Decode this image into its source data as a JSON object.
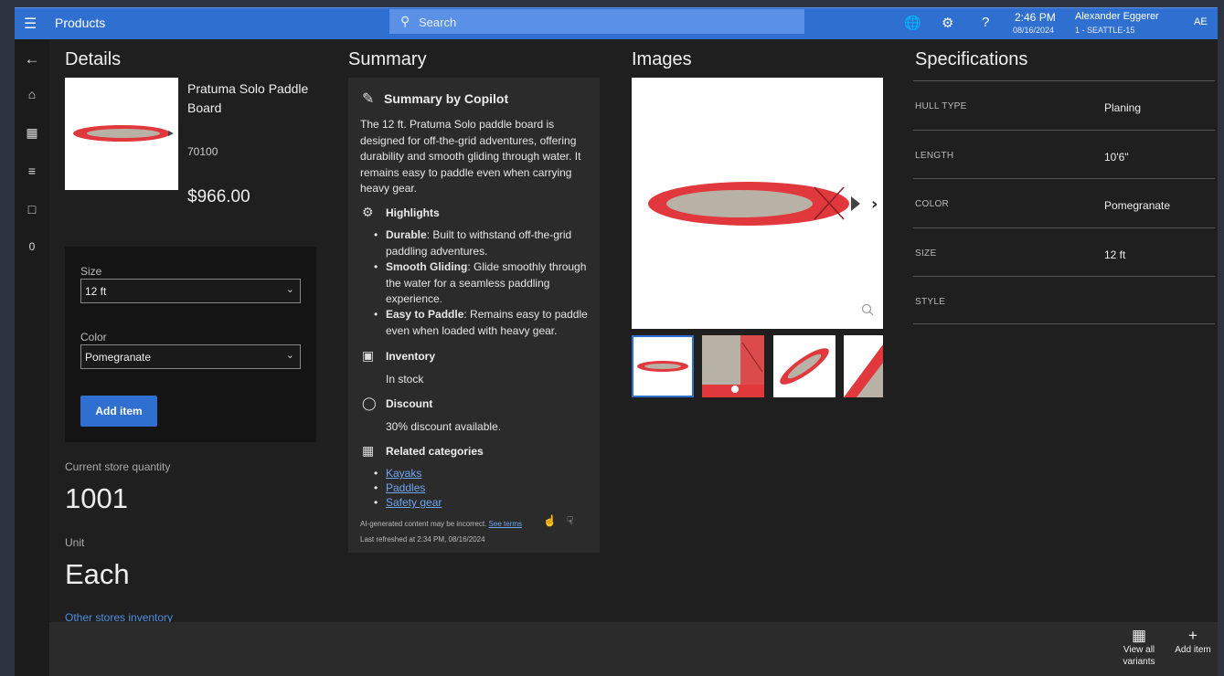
{
  "topbar": {
    "menu_icon": "hamburger-icon",
    "title": "Products",
    "search_placeholder": "Search",
    "time": "2:46 PM",
    "date": "08/16/2024",
    "user": "Alexander Eggerer",
    "store": "1 - SEATTLE-15",
    "initials": "AE",
    "accent": "#2f6fcf"
  },
  "rail": {
    "items": [
      "back-icon",
      "home-icon",
      "products-icon",
      "list-icon",
      "bag-icon"
    ],
    "cart_count": "0"
  },
  "details": {
    "heading": "Details",
    "name": "Pratuma Solo Paddle Board",
    "number": "70100",
    "price": "$966.00",
    "size_label": "Size",
    "size_value": "12 ft",
    "color_label": "Color",
    "color_value": "Pomegranate",
    "add_label": "Add item",
    "qty_label": "Current store quantity",
    "qty_value": "1001",
    "unit_label": "Unit",
    "unit_value": "Each",
    "other_stores": "Other stores inventory"
  },
  "summary": {
    "heading": "Summary",
    "title": "Summary by Copilot",
    "description": "The 12 ft. Pratuma Solo paddle board is designed for off-the-grid adventures, offering durability and smooth gliding through water. It remains easy to paddle even when carrying heavy gear.",
    "highlights_label": "Highlights",
    "highlights": [
      {
        "term": "Durable",
        "text": ": Built to withstand off-the-grid paddling adventures."
      },
      {
        "term": "Smooth Gliding",
        "text": ": Glide smoothly through the water for a seamless paddling experience."
      },
      {
        "term": "Easy to Paddle",
        "text": ": Remains easy to paddle even when loaded with heavy gear."
      }
    ],
    "inventory_label": "Inventory",
    "inventory_value": "In stock",
    "discount_label": "Discount",
    "discount_value": "30% discount available.",
    "related_label": "Related categories",
    "related": [
      "Kayaks",
      "Paddles",
      "Safety gear"
    ],
    "disclaimer": "AI-generated content may be incorrect.",
    "see_terms": "See terms",
    "refreshed": "Last refreshed at 2:34 PM, 08/16/2024"
  },
  "images": {
    "heading": "Images",
    "board_color": "#e0383c",
    "deck_color": "#b8b2a6"
  },
  "specs": {
    "heading": "Specifications",
    "rows": [
      {
        "key": "HULL TYPE",
        "value": "Planing"
      },
      {
        "key": "LENGTH",
        "value": "10'6\""
      },
      {
        "key": "COLOR",
        "value": "Pomegranate"
      },
      {
        "key": "SIZE",
        "value": "12 ft"
      },
      {
        "key": "STYLE",
        "value": ""
      }
    ]
  },
  "bottombar": {
    "view_all": "View all variants",
    "add_item": "Add item"
  }
}
